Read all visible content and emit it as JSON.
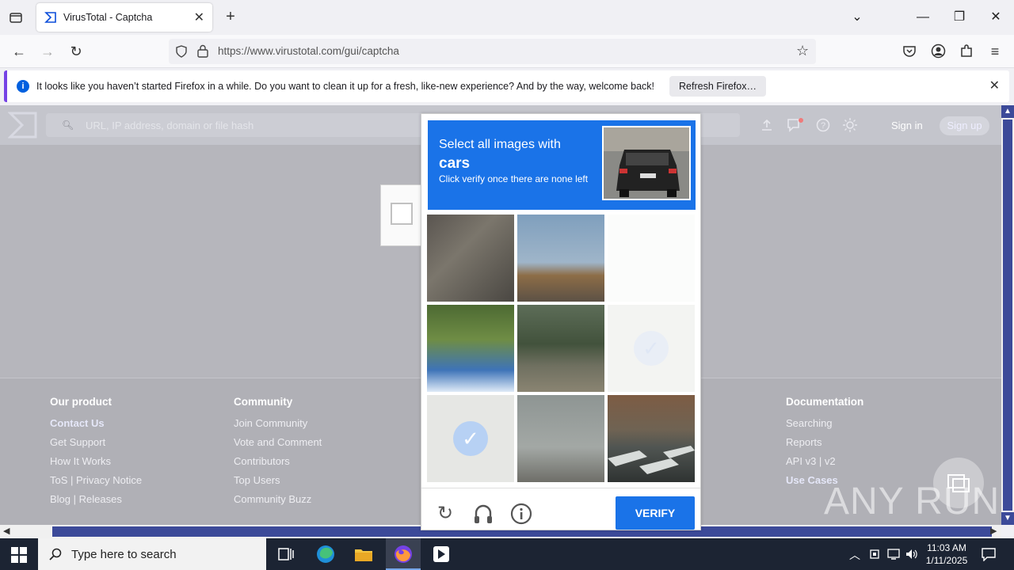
{
  "browser": {
    "tab_title": "VirusTotal - Captcha",
    "url": "https://www.virustotal.com/gui/captcha"
  },
  "notification": {
    "message": "It looks like you haven’t started Firefox in a while. Do you want to clean it up for a fresh, like-new experience? And by the way, welcome back!",
    "button": "Refresh Firefox…"
  },
  "vt": {
    "search_placeholder": "URL, IP address, domain or file hash",
    "sign_in": "Sign in",
    "sign_up": "Sign up"
  },
  "footer": {
    "our_product": {
      "heading": "Our product",
      "items": [
        "Contact Us",
        "Get Support",
        "How It Works",
        "ToS | Privacy Notice",
        "Blog | Releases"
      ]
    },
    "community": {
      "heading": "Community",
      "items": [
        "Join Community",
        "Vote and Comment",
        "Contributors",
        "Top Users",
        "Community Buzz"
      ]
    },
    "documentation": {
      "heading": "Documentation",
      "items": [
        "Searching",
        "Reports",
        "API v3 | v2",
        "Use Cases"
      ]
    }
  },
  "challenge": {
    "line1": "Select all images with",
    "target": "cars",
    "line3": "Click verify once there are none left",
    "verify": "VERIFY"
  },
  "taskbar": {
    "search_text": "Type here to search",
    "time": "11:03 AM",
    "date": "1/11/2025"
  },
  "watermark": "ANY RUN"
}
